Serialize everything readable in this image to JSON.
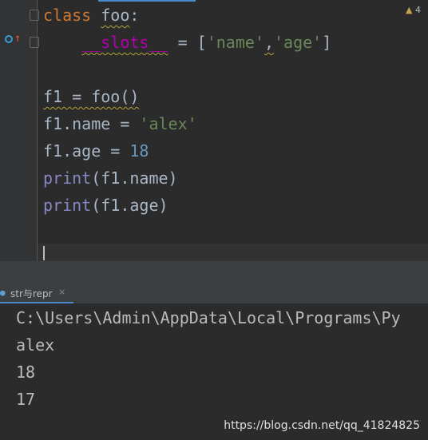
{
  "editor": {
    "inspection_count": "4",
    "lines": {
      "l1": {
        "kw": "class",
        "name": "foo",
        "colon": ":"
      },
      "l2": {
        "indent": "    ",
        "slots": "__slots__",
        "eq": " = [",
        "s1": "'name'",
        "comma": ",",
        "s2": "'age'",
        "close": "]"
      },
      "l4": {
        "text": "f1 = foo()"
      },
      "l5": {
        "pre": "f1.name = ",
        "str": "'alex'"
      },
      "l6": {
        "pre": "f1.age = ",
        "num": "18"
      },
      "l7": {
        "fn": "print",
        "args": "(f1.name)"
      },
      "l8": {
        "fn": "print",
        "args": "(f1.age)"
      }
    }
  },
  "run_panel": {
    "tab_label": "str与repr",
    "close_glyph": "×",
    "output": [
      "C:\\Users\\Admin\\AppData\\Local\\Programs\\Py",
      "alex",
      "18",
      "17"
    ]
  },
  "watermark": "https://blog.csdn.net/qq_41824825"
}
